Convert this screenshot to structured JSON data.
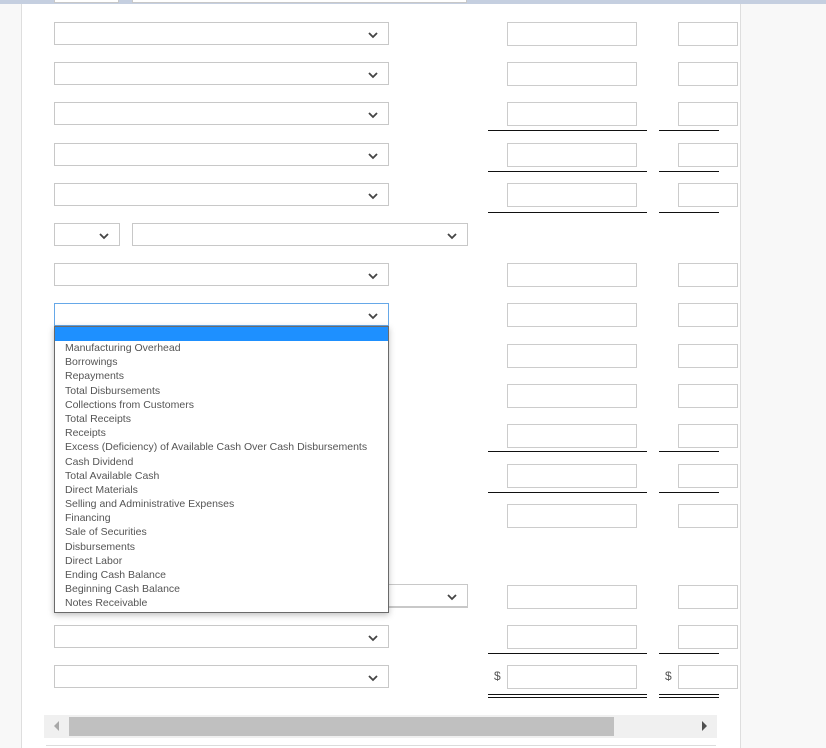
{
  "form": {
    "rows": [
      {
        "type": "select"
      },
      {
        "type": "select"
      },
      {
        "type": "select"
      },
      {
        "type": "select"
      },
      {
        "type": "select"
      },
      {
        "type": "split-select",
        "separator": ":"
      },
      {
        "type": "select"
      },
      {
        "type": "select",
        "state": "open"
      },
      {
        "type": "select"
      },
      {
        "type": "select"
      },
      {
        "type": "select"
      },
      {
        "type": "select"
      },
      {
        "type": "select"
      },
      {
        "type": "select"
      },
      {
        "type": "split-select",
        "separator": ":"
      },
      {
        "type": "select",
        "currency_symbol": "$"
      }
    ],
    "currency_symbol": "$",
    "separator": ":"
  },
  "dropdown": {
    "selected_index": 0,
    "options": [
      "",
      "Manufacturing Overhead",
      "Borrowings",
      "Repayments",
      "Total Disbursements",
      "Collections from Customers",
      "Total Receipts",
      "Receipts",
      "Excess (Deficiency) of Available Cash Over Cash Disbursements",
      "Cash Dividend",
      "Total Available Cash",
      "Direct Materials",
      "Selling and Administrative Expenses",
      "Financing",
      "Sale of Securities",
      "Disbursements",
      "Direct Labor",
      "Ending Cash Balance",
      "Beginning Cash Balance",
      "Notes Receivable"
    ]
  },
  "colors": {
    "highlight": "#1e90ff",
    "top_bar": "#c5cfe0",
    "focus_border": "#66a8e8"
  },
  "icons": {
    "select_arrow": "chevron-down-icon",
    "scroll_left": "triangle-left-icon",
    "scroll_right": "triangle-right-icon"
  }
}
